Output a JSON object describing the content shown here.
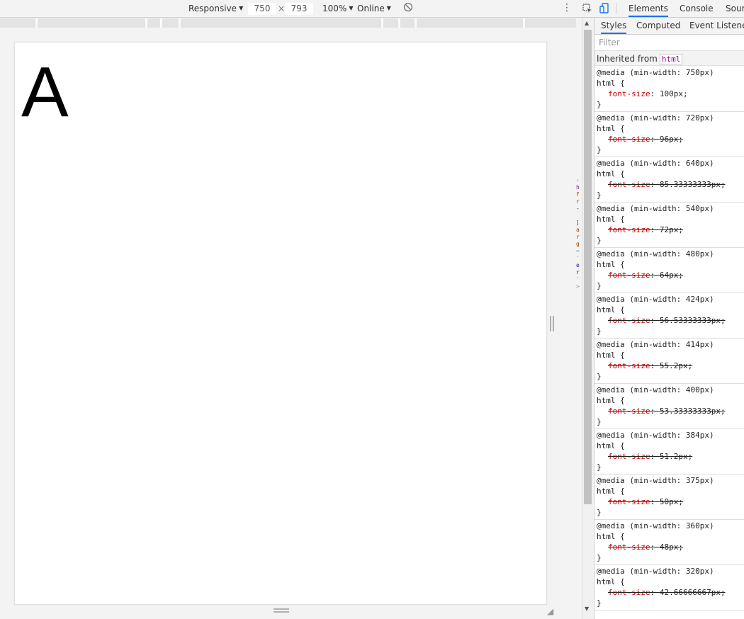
{
  "device_toolbar": {
    "device": "Responsive",
    "width": "750",
    "times": "×",
    "height": "793",
    "zoom": "100%",
    "network": "Online"
  },
  "viewport": {
    "content": "A"
  },
  "devtools": {
    "tabs": [
      "Elements",
      "Console",
      "Sour"
    ],
    "subtabs": [
      "Styles",
      "Computed",
      "Event Listeners"
    ],
    "filter_placeholder": "Filter",
    "inherited_label": "Inherited from",
    "inherited_tag": "html",
    "rules": [
      {
        "media": "@media (min-width: 750px)",
        "selector": "html {",
        "prop": "font-size",
        "value": "100px;",
        "overridden": false
      },
      {
        "media": "@media (min-width: 720px)",
        "selector": "html {",
        "prop": "font-size",
        "value": "96px;",
        "overridden": true
      },
      {
        "media": "@media (min-width: 640px)",
        "selector": "html {",
        "prop": "font-size",
        "value": "85.33333333px;",
        "overridden": true
      },
      {
        "media": "@media (min-width: 540px)",
        "selector": "html {",
        "prop": "font-size",
        "value": "72px;",
        "overridden": true
      },
      {
        "media": "@media (min-width: 480px)",
        "selector": "html {",
        "prop": "font-size",
        "value": "64px;",
        "overridden": true
      },
      {
        "media": "@media (min-width: 424px)",
        "selector": "html {",
        "prop": "font-size",
        "value": "56.53333333px;",
        "overridden": true
      },
      {
        "media": "@media (min-width: 414px)",
        "selector": "html {",
        "prop": "font-size",
        "value": "55.2px;",
        "overridden": true
      },
      {
        "media": "@media (min-width: 400px)",
        "selector": "html {",
        "prop": "font-size",
        "value": "53.33333333px;",
        "overridden": true
      },
      {
        "media": "@media (min-width: 384px)",
        "selector": "html {",
        "prop": "font-size",
        "value": "51.2px;",
        "overridden": true
      },
      {
        "media": "@media (min-width: 375px)",
        "selector": "html {",
        "prop": "font-size",
        "value": "50px;",
        "overridden": true
      },
      {
        "media": "@media (min-width: 360px)",
        "selector": "html {",
        "prop": "font-size",
        "value": "48px;",
        "overridden": true
      },
      {
        "media": "@media (min-width: 320px)",
        "selector": "html {",
        "prop": "font-size",
        "value": "42.66666667px;",
        "overridden": true
      }
    ],
    "closing_brace": "}"
  },
  "icons": {
    "inspect": "inspect-element-icon",
    "device": "device-toggle-icon",
    "more": "more-vertical-icon",
    "rotate": "rotate-icon"
  },
  "colors": {
    "accent": "#1a73e8",
    "property": "#c80000",
    "tag": "#881280"
  }
}
